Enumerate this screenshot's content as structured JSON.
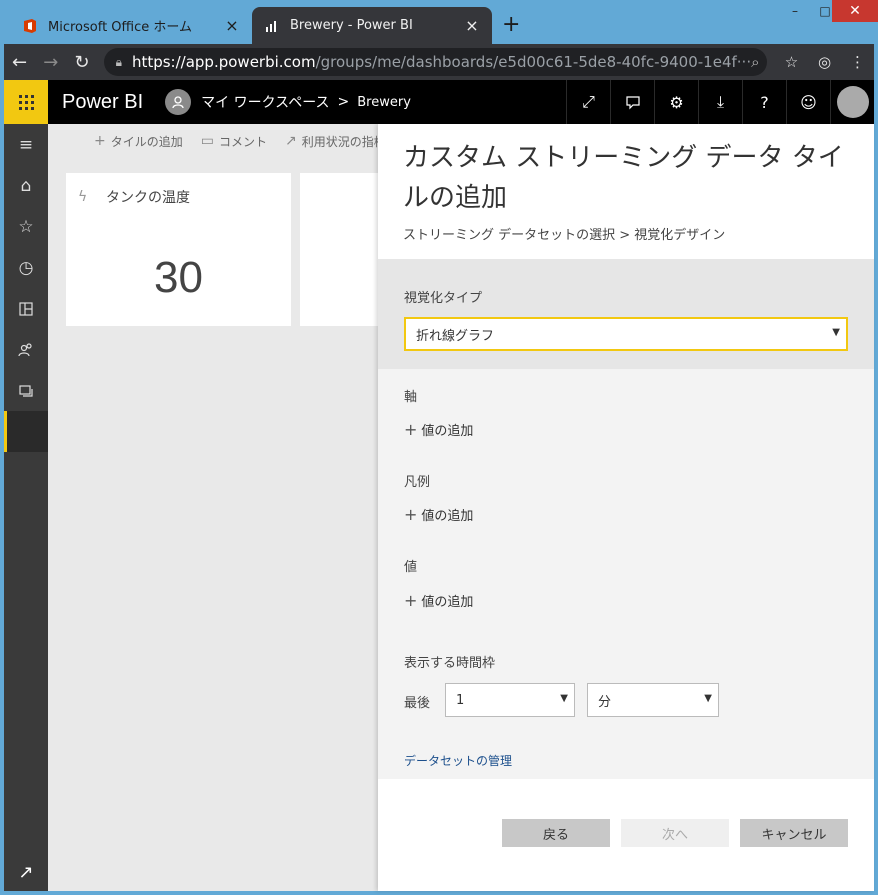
{
  "browser": {
    "tabs": [
      {
        "label": "Microsoft Office ホーム",
        "active": false
      },
      {
        "label": "Brewery - Power BI",
        "active": true
      }
    ],
    "close_glyph": "×",
    "new_tab_glyph": "+",
    "window_controls": [
      "–",
      "□",
      "✕"
    ],
    "url_host": "https://app.powerbi.com",
    "url_path": "/groups/me/dashboards/e5d00c61-5de8-40fc-9400-1e4f···",
    "nav_icons": [
      "back-icon",
      "forward-icon",
      "reload-icon"
    ],
    "right_icons": [
      "zoom-icon",
      "star-icon",
      "incognito-icon",
      "menu-icon"
    ]
  },
  "header": {
    "brand": "Power BI",
    "workspace": "マイ ワークスペース",
    "separator": ">",
    "dashboard": "Brewery",
    "icons": [
      "fullscreen-icon",
      "comment-icon",
      "settings-icon",
      "download-icon",
      "help-icon",
      "feedback-icon",
      "account-icon"
    ]
  },
  "leftnav": {
    "items": [
      "hamburger-icon",
      "home-icon",
      "favorites-icon",
      "recent-icon",
      "apps-icon",
      "shared-icon",
      "workspaces-icon",
      "current-workspace"
    ]
  },
  "toolbar": {
    "add_tile": "タイルの追加",
    "comment": "コメント",
    "usage_metrics": "利用状況の指標"
  },
  "tiles": [
    {
      "title": "タンクの温度",
      "value": "30"
    }
  ],
  "panel": {
    "title": "カスタム ストリーミング データ タイルの追加",
    "breadcrumb": "ストリーミング データセットの選択 > 視覚化デザイン",
    "vis_type_label": "視覚化タイプ",
    "vis_type_value": "折れ線グラフ",
    "axis_label": "軸",
    "legend_label": "凡例",
    "values_label": "値",
    "add_value": "値の追加",
    "timeframe_label": "表示する時間枠",
    "last_label": "最後",
    "last_value": "1",
    "unit_value": "分",
    "manage_datasets": "データセットの管理",
    "back_button": "戻る",
    "next_button": "次へ",
    "cancel_button": "キャンセル"
  },
  "colors": {
    "accent": "#f2c811",
    "window_frame": "#62a9d6",
    "tab_active": "#35363a",
    "header_bg": "#000000",
    "nav_bg": "#3a3a3a"
  }
}
